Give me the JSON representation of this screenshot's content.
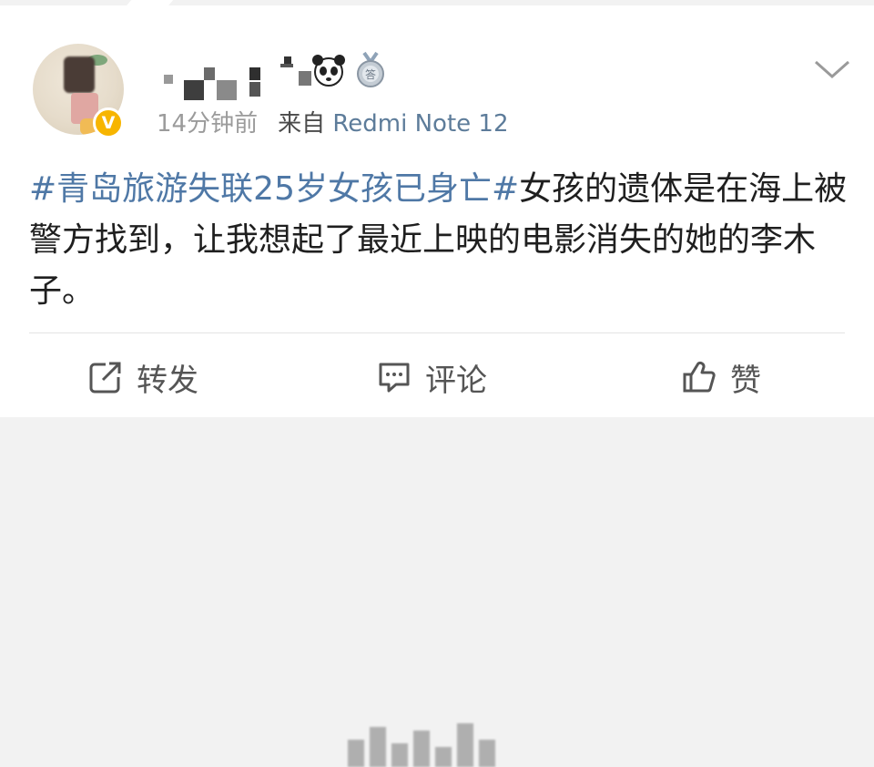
{
  "post": {
    "verified_badge": "V",
    "meta": {
      "time": "14分钟前",
      "source_prefix": "来自",
      "device": "Redmi Note 12"
    },
    "content": {
      "hashtag": "#青岛旅游失联25岁女孩已身亡#",
      "text": "女孩的遗体是在海上被警方找到，让我想起了最近上映的电影消失的她的李木子。"
    },
    "actions": {
      "repost": "转发",
      "comment": "评论",
      "like": "赞"
    }
  },
  "colors": {
    "link": "#4f78a6",
    "device": "#5d7c9a",
    "verified": "#f7b500",
    "meta": "#9b9b9b",
    "text": "#1f1f1f"
  },
  "icons": [
    "panda-icon",
    "medal-icon",
    "chevron-down-icon",
    "repost-icon",
    "comment-icon",
    "like-icon",
    "verified-icon"
  ]
}
